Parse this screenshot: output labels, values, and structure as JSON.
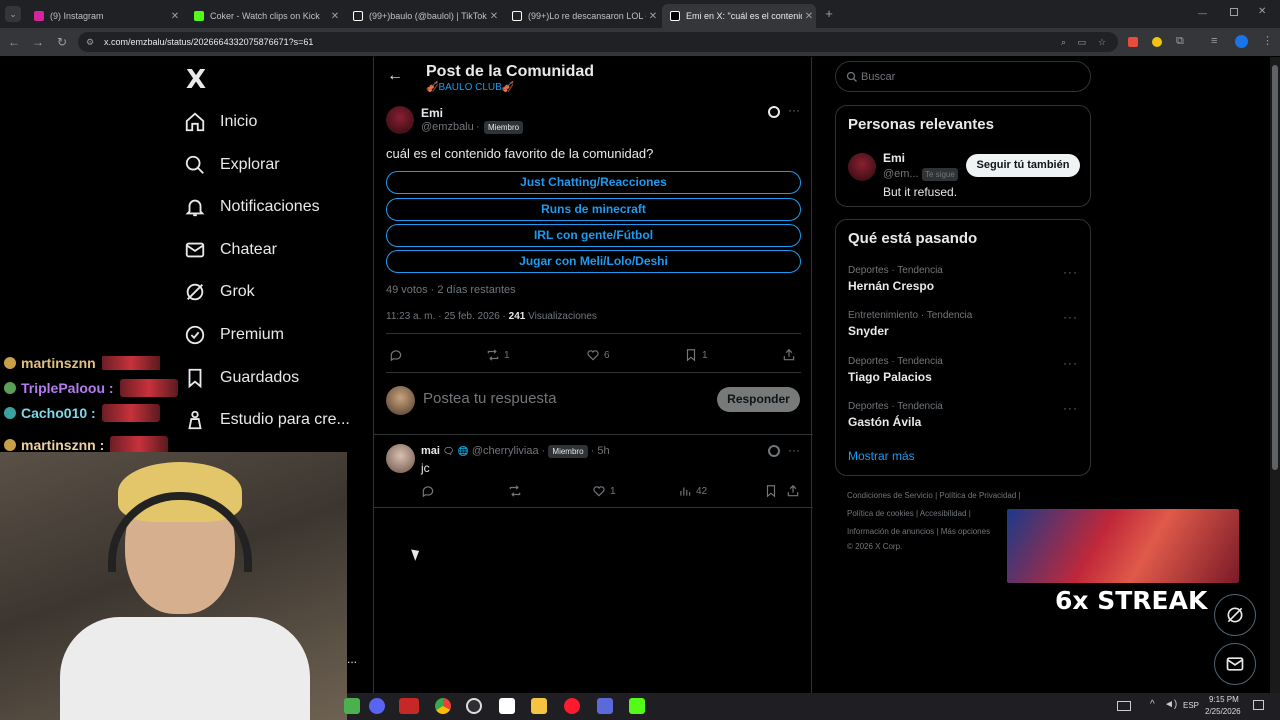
{
  "browser": {
    "tabs": [
      {
        "title": "(9) Instagram",
        "color": "#d6249f"
      },
      {
        "title": "Coker - Watch clips on Kick",
        "color": "#53fc18"
      },
      {
        "title": "(99+)baulo (@baulol) | TikTok",
        "color": "#ffffff"
      },
      {
        "title": "(99+)Lo re descansaron LOL #",
        "color": "#ffffff"
      },
      {
        "title": "Emi en X: \"cuál es el contenido",
        "color": "#ffffff"
      }
    ],
    "new_tab": "+",
    "url": "x.com/emzbalu/status/2026664332075876671?s=61"
  },
  "chat": [
    {
      "user": "martinsznn",
      "color": "#e0c080"
    },
    {
      "user": "TriplePaloou :",
      "color": "#b57cf0"
    },
    {
      "user": "Cacho010 :",
      "color": "#7fd8e8"
    },
    {
      "user": "martinsznn :",
      "color": "#f0d0a0"
    }
  ],
  "nav": {
    "logo": "X",
    "items": [
      "Inicio",
      "Explorar",
      "Notificaciones",
      "Chatear",
      "Grok",
      "Premium",
      "Guardados",
      "Estudio para cre..."
    ],
    "more": "..."
  },
  "header": {
    "title": "Post de la Comunidad",
    "community": "🎻BAULO CLUB🎻"
  },
  "post": {
    "name": "Emi",
    "handle": "@emzbalu",
    "member_badge": "Miembro",
    "text": "cuál es el contenido favorito de la comunidad?",
    "poll_options": [
      "Just Chatting/Reacciones",
      "Runs de minecraft",
      "IRL con gente/Fútbol",
      "Jugar con Meli/Lolo/Deshi"
    ],
    "poll_meta": "49 votos · 2 días restantes",
    "time": "11:23 a. m. · 25 feb. 2026 ·",
    "views_count": "241",
    "views_label": "Visualizaciones",
    "retweets": "1",
    "likes": "6",
    "bookmarks": "1"
  },
  "reply_box": {
    "placeholder": "Postea tu respuesta",
    "button": "Responder"
  },
  "reply": {
    "name": "mai",
    "handle": "@cherryliviaa",
    "member_badge": "Miembro",
    "age": "5h",
    "text": "jc",
    "likes": "1",
    "views": "42"
  },
  "search": {
    "placeholder": "Buscar"
  },
  "relevant": {
    "title": "Personas relevantes",
    "name": "Emi",
    "handle": "@em...",
    "follows_you": "Te sigue",
    "follow_button": "Seguir tú también",
    "bio": "But it refused."
  },
  "trending": {
    "title": "Qué está pasando",
    "items": [
      {
        "category": "Deportes · Tendencia",
        "name": "Hernán Crespo"
      },
      {
        "category": "Entretenimiento · Tendencia",
        "name": "Snyder"
      },
      {
        "category": "Deportes · Tendencia",
        "name": "Tiago Palacios"
      },
      {
        "category": "Deportes · Tendencia",
        "name": "Gastón Ávila"
      }
    ],
    "show_more": "Mostrar más"
  },
  "footer": {
    "links": [
      "Condiciones de Servicio",
      "Política de Privacidad",
      "Política de cookies",
      "Accesibilidad",
      "Información de anuncios",
      "Más opciones"
    ],
    "copyright": "© 2026 X Corp."
  },
  "overlay": {
    "streak": "6x STREAK"
  },
  "taskbar": {
    "lang": "ESP",
    "time": "9:15 PM",
    "date": "2/25/2026"
  }
}
